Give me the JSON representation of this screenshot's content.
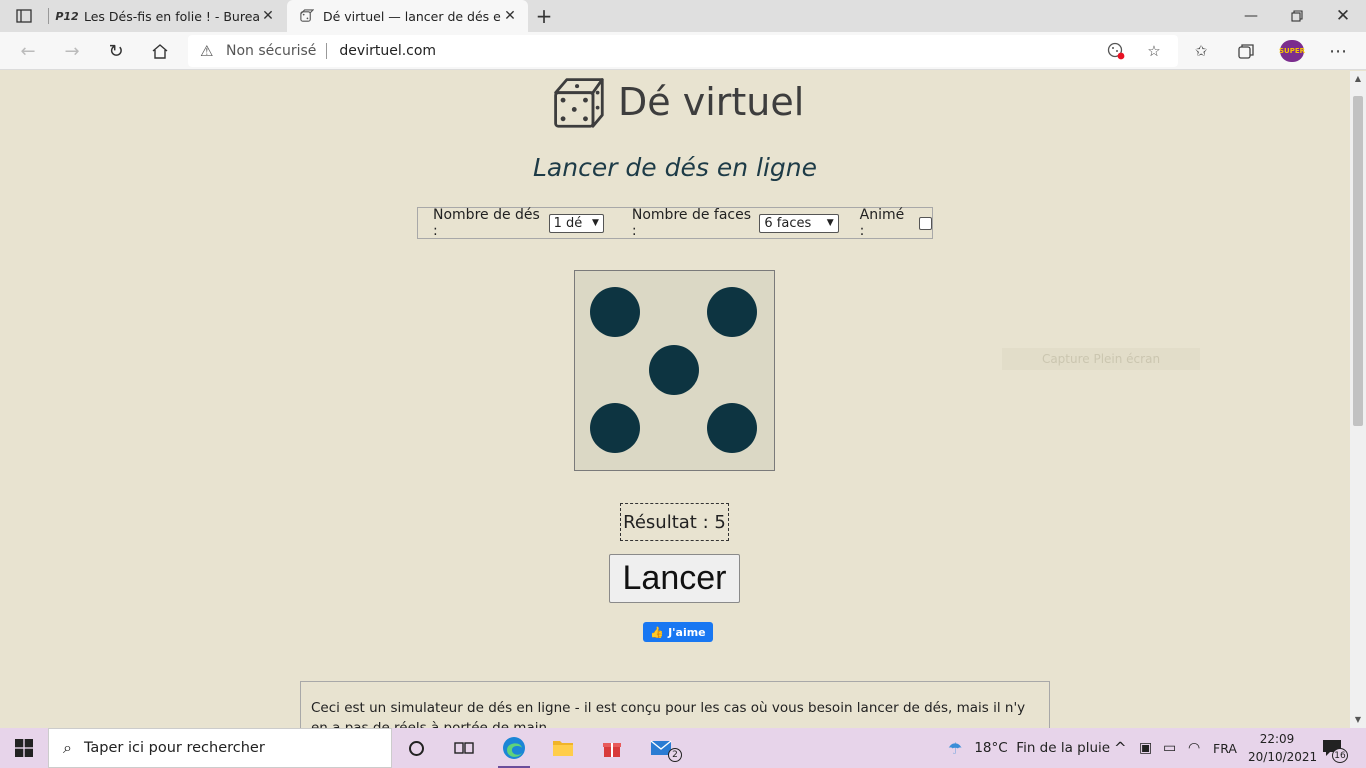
{
  "browser": {
    "tabs": [
      {
        "favicon": "P12",
        "title": "Les Dés-fis en folie ! - Bureau de",
        "active": false
      },
      {
        "favicon": "dice-favicon",
        "title": "Dé virtuel — lancer de dés en lig",
        "active": true
      }
    ],
    "security_label": "Non sécurisé",
    "url": "devirtuel.com",
    "profile_badge": "SUPER"
  },
  "page": {
    "site_title": "Dé virtuel",
    "subtitle": "Lancer de dés en ligne",
    "controls": {
      "dice_count_label": "Nombre de dés :",
      "dice_count_value": "1 dé",
      "faces_label": "Nombre de faces :",
      "faces_value": "6 faces",
      "animated_label": "Animé :",
      "animated_checked": false
    },
    "die": {
      "face": 5,
      "pip_color": "#0d3441",
      "face_color": "#dbd8c5"
    },
    "ghost_text": "Capture Plein écran",
    "result_text": "Résultat : 5",
    "roll_button": "Lancer",
    "like_button": "J'aime",
    "info_text": "Ceci est un simulateur de dés en ligne - il est conçu pour les cas où vous besoin lancer de dés, mais il n'y en a pas de réels à portée de main."
  },
  "taskbar": {
    "search_placeholder": "Taper ici pour rechercher",
    "mail_badge": "2",
    "weather": "18°C  Fin de la pluie",
    "language": "FRA",
    "time": "22:09",
    "date": "20/10/2021",
    "notification_count": "16"
  }
}
